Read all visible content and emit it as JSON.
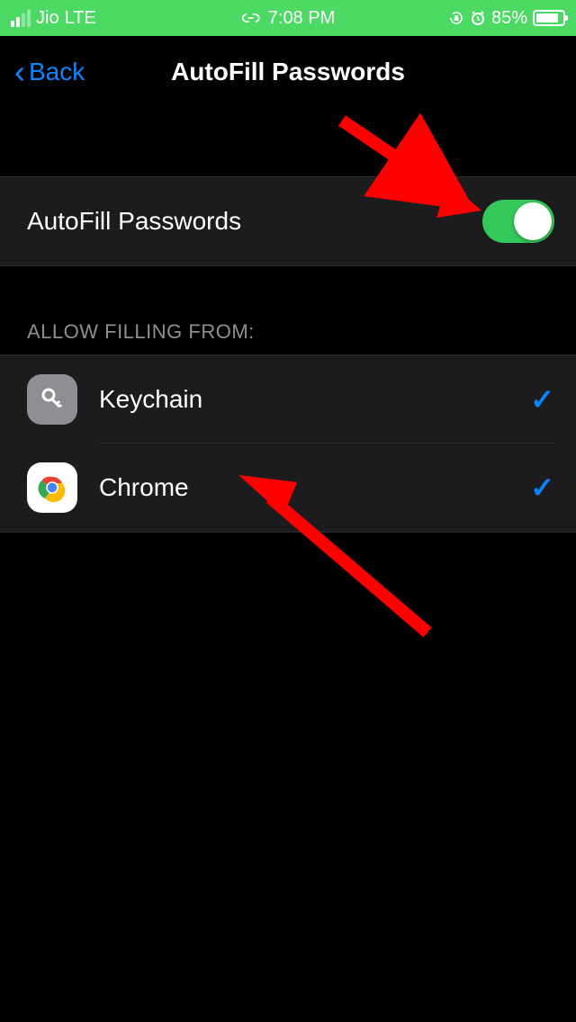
{
  "statusBar": {
    "carrier": "Jio",
    "network": "LTE",
    "time": "7:08 PM",
    "batteryPercent": "85%"
  },
  "nav": {
    "backLabel": "Back",
    "title": "AutoFill Passwords"
  },
  "toggle": {
    "label": "AutoFill Passwords",
    "on": true
  },
  "sectionHeader": "ALLOW FILLING FROM:",
  "providers": [
    {
      "label": "Keychain",
      "checked": true,
      "icon": "keychain"
    },
    {
      "label": "Chrome",
      "checked": true,
      "icon": "chrome"
    }
  ]
}
